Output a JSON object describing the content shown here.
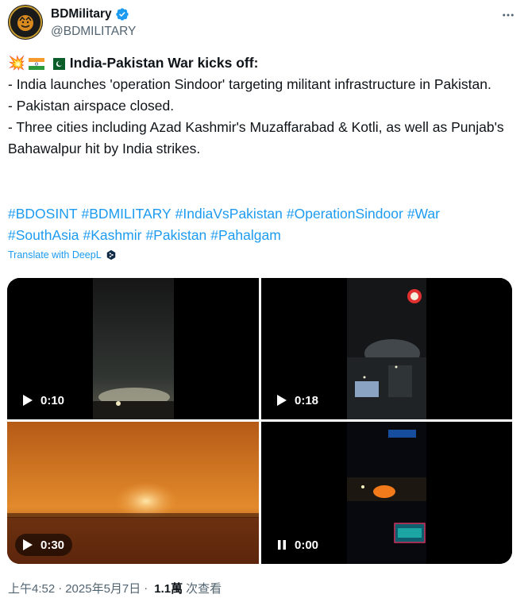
{
  "author": {
    "display_name": "BDMilitary",
    "handle": "@BDMILITARY"
  },
  "post": {
    "headline": "India-Pakistan War kicks off:",
    "lines": [
      "- India launches 'operation Sindoor' targeting militant infrastructure in Pakistan.",
      "- Pakistan airspace closed.",
      "- Three cities including Azad Kashmir's Muzaffarabad & Kotli, as well as Punjab's Bahawalpur hit by India strikes."
    ],
    "hashtags": [
      "#BDOSINT",
      "#BDMILITARY",
      "#IndiaVsPakistan",
      "#OperationSindoor",
      "#War",
      "#SouthAsia",
      "#Kashmir",
      "#Pakistan",
      "#Pahalgam"
    ],
    "translate_label": "Translate with DeepL"
  },
  "media": [
    {
      "duration": "0:10",
      "control": "play-icon"
    },
    {
      "duration": "0:18",
      "control": "play-icon"
    },
    {
      "duration": "0:30",
      "control": "play-icon"
    },
    {
      "duration": "0:00",
      "control": "pause-icon"
    }
  ],
  "meta": {
    "time": "上午4:52",
    "date": "2025年5月7日",
    "views_count": "1.1萬",
    "views_label": "次查看"
  },
  "colors": {
    "link": "#1d9bf0",
    "verified": "#1d9bf0",
    "secondary_text": "#536471"
  }
}
